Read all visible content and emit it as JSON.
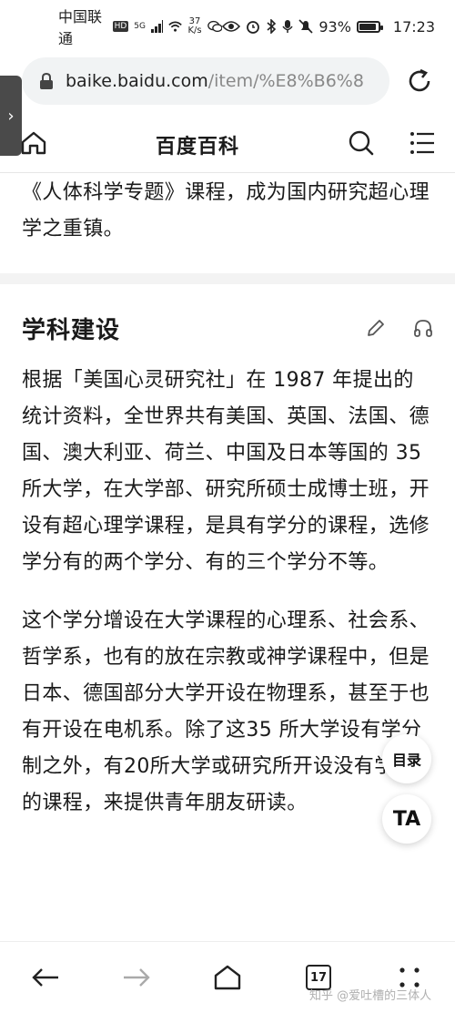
{
  "status_bar": {
    "carrier": "中国联通",
    "hd": "HD",
    "network": "5G",
    "speed_value": "37",
    "speed_unit": "K/s",
    "battery": "93%",
    "battery_level": 0.93,
    "time": "17:23"
  },
  "browser": {
    "url_host": "baike.baidu.com",
    "url_path": "/item/%E8%B6%8"
  },
  "app_bar": {
    "title": "百度百科"
  },
  "content": {
    "intro_paragraph": "《人体科学专题》课程，成为国内研究超心理学之重镇。",
    "section_title": "学科建设",
    "paragraphs": [
      "根据「美国心灵研究社」在 1987 年提出的统计资料，全世界共有美国、英国、法国、德国、澳大利亚、荷兰、中国及日本等国的 35 所大学，在大学部、研究所硕士成博士班，开设有超心理学课程，是具有学分的课程，选修学分有的两个学分、有的三个学分不等。",
      "这个学分增设在大学课程的心理系、社会系、哲学系，也有的放在宗教或神学课程中，但是日本、德国部分大学开设在物理系，甚至于也有开设在电机系。除了这35 所大学设有学分制之外，有20所大学或研究所开设没有学分的课程，来提供青年朋友研读。"
    ]
  },
  "floating": {
    "toc_label": "目录",
    "ta_label": "TA"
  },
  "bottom_nav": {
    "tab_count": "17"
  },
  "watermark": "知乎 @爱吐槽的三体人"
}
